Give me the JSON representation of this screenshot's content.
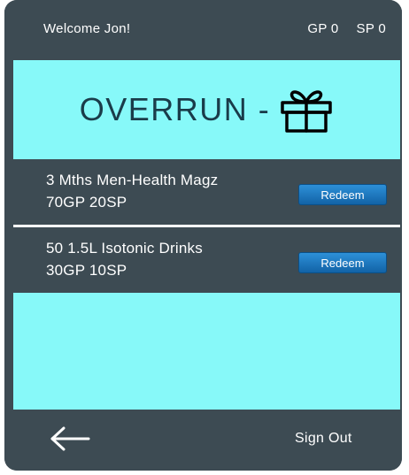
{
  "header": {
    "welcome": "Welcome Jon!",
    "gp_label": "GP 0",
    "sp_label": "SP 0"
  },
  "banner": {
    "title": "OVERRUN -",
    "icon": "gift-icon"
  },
  "rewards": [
    {
      "name": "3 Mths Men-Health Magz",
      "cost": "70GP 20SP",
      "button": "Redeem"
    },
    {
      "name": "50 1.5L Isotonic Drinks",
      "cost": "30GP 10SP",
      "button": "Redeem"
    }
  ],
  "footer": {
    "back_icon": "arrow-left-icon",
    "sign_out": "Sign Out"
  },
  "colors": {
    "frame": "#3d4b53",
    "content_bg": "#87f9f9",
    "button": "#1a78c2",
    "title": "#1a3c4a"
  }
}
